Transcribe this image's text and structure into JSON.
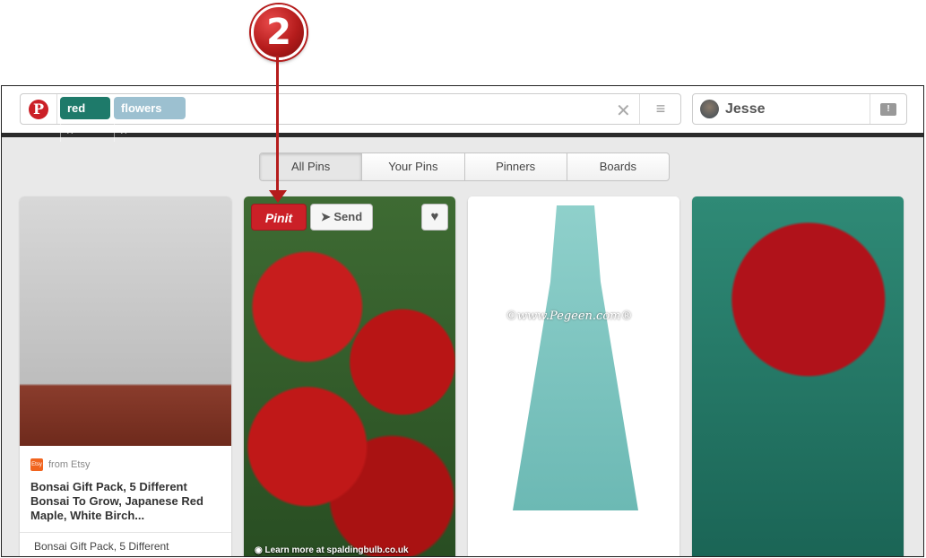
{
  "callout": {
    "number": "2"
  },
  "header": {
    "logo": "P",
    "tags": [
      {
        "label": "red",
        "color": "#1e7a6a"
      },
      {
        "label": "flowers",
        "color": "#9cc0d0"
      }
    ],
    "tag_remove": "×",
    "clear": "✕",
    "menu": "≡",
    "user": {
      "name": "Jesse"
    },
    "notifications_icon": "speech-bubble-icon"
  },
  "tabs": [
    {
      "label": "All Pins",
      "active": true
    },
    {
      "label": "Your Pins",
      "active": false
    },
    {
      "label": "Pinners",
      "active": false
    },
    {
      "label": "Boards",
      "active": false
    }
  ],
  "pins": [
    {
      "source": "from Etsy",
      "source_badge": "Etsy",
      "title": "Bonsai Gift Pack, 5 Different Bonsai To Grow, Japanese Red Maple, White Birch...",
      "description": "Bonsai Gift Pack, 5 Different"
    },
    {
      "pinit_label": "Pinit",
      "send_label": "Send",
      "like_icon": "heart-icon",
      "learn_more": "Learn more at spaldingbulb.co.uk"
    },
    {
      "watermark": "©www.Pegeen.com®"
    },
    {}
  ]
}
